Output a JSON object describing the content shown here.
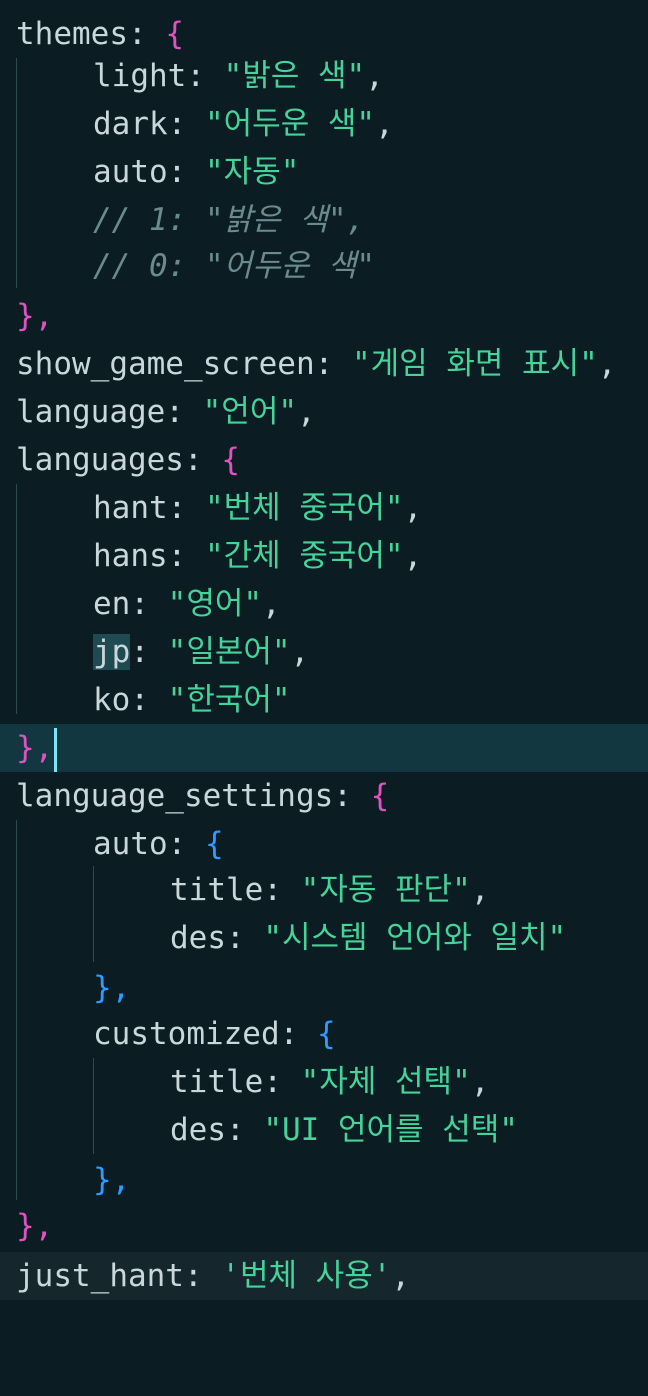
{
  "editor": {
    "lines": [
      {
        "key": "themes",
        "open": "{"
      },
      {
        "key": "light",
        "value": "\"밝은 색\"",
        "comma": ","
      },
      {
        "key": "dark",
        "value": "\"어두운 색\"",
        "comma": ","
      },
      {
        "key": "auto",
        "value": "\"자동\"",
        "comma": ""
      },
      {
        "comment": "// 1: \"밝은 색\","
      },
      {
        "comment": "// 0: \"어두운 색\""
      },
      {
        "close": "},"
      },
      {
        "key": "show_game_screen",
        "value": "\"게임 화면 표시\"",
        "comma": ","
      },
      {
        "key": "language",
        "value": "\"언어\"",
        "comma": ","
      },
      {
        "key": "languages",
        "open": "{"
      },
      {
        "key": "hant",
        "value": "\"번체 중국어\"",
        "comma": ","
      },
      {
        "key": "hans",
        "value": "\"간체 중국어\"",
        "comma": ","
      },
      {
        "key": "en",
        "value": "\"영어\"",
        "comma": ","
      },
      {
        "key": "jp",
        "value": "\"일본어\"",
        "comma": ","
      },
      {
        "key": "ko",
        "value": "\"한국어\"",
        "comma": ""
      },
      {
        "close": "},"
      },
      {
        "key": "language_settings",
        "open": "{"
      },
      {
        "key": "auto",
        "open": "{"
      },
      {
        "key": "title",
        "value": "\"자동 판단\"",
        "comma": ","
      },
      {
        "key": "des",
        "value": "\"시스템 언어와 일치\"",
        "comma": ""
      },
      {
        "close": "},"
      },
      {
        "key": "customized",
        "open": "{"
      },
      {
        "key": "title",
        "value": "\"자체 선택\"",
        "comma": ","
      },
      {
        "key": "des",
        "value": "\"UI 언어를 선택\"",
        "comma": ""
      },
      {
        "close": "},"
      },
      {
        "close": "},"
      },
      {
        "key": "just_hant",
        "value": "'번체 사용'",
        "comma": ","
      }
    ]
  }
}
